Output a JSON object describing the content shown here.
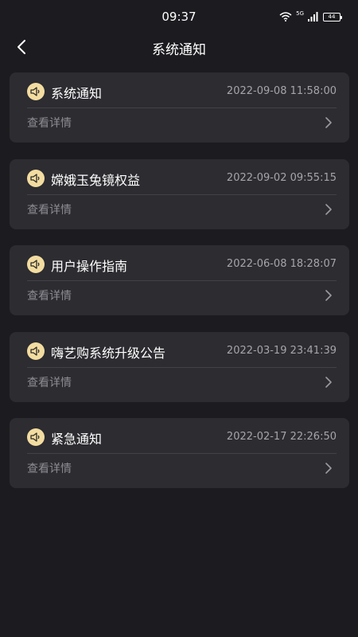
{
  "status": {
    "time": "09:37",
    "network": "5G",
    "battery": "44"
  },
  "header": {
    "title": "系统通知"
  },
  "notifications": [
    {
      "title": "系统通知",
      "time": "2022-09-08 11:58:00",
      "action": "查看详情"
    },
    {
      "title": "嫦娥玉兔镜权益",
      "time": "2022-09-02 09:55:15",
      "action": "查看详情"
    },
    {
      "title": "用户操作指南",
      "time": "2022-06-08 18:28:07",
      "action": "查看详情"
    },
    {
      "title": "嗨艺购系统升级公告",
      "time": "2022-03-19 23:41:39",
      "action": "查看详情"
    },
    {
      "title": "紧急通知",
      "time": "2022-02-17 22:26:50",
      "action": "查看详情"
    }
  ],
  "colors": {
    "background": "#1c1c20",
    "card": "#2c2c31",
    "accent": "#f3dca0"
  }
}
